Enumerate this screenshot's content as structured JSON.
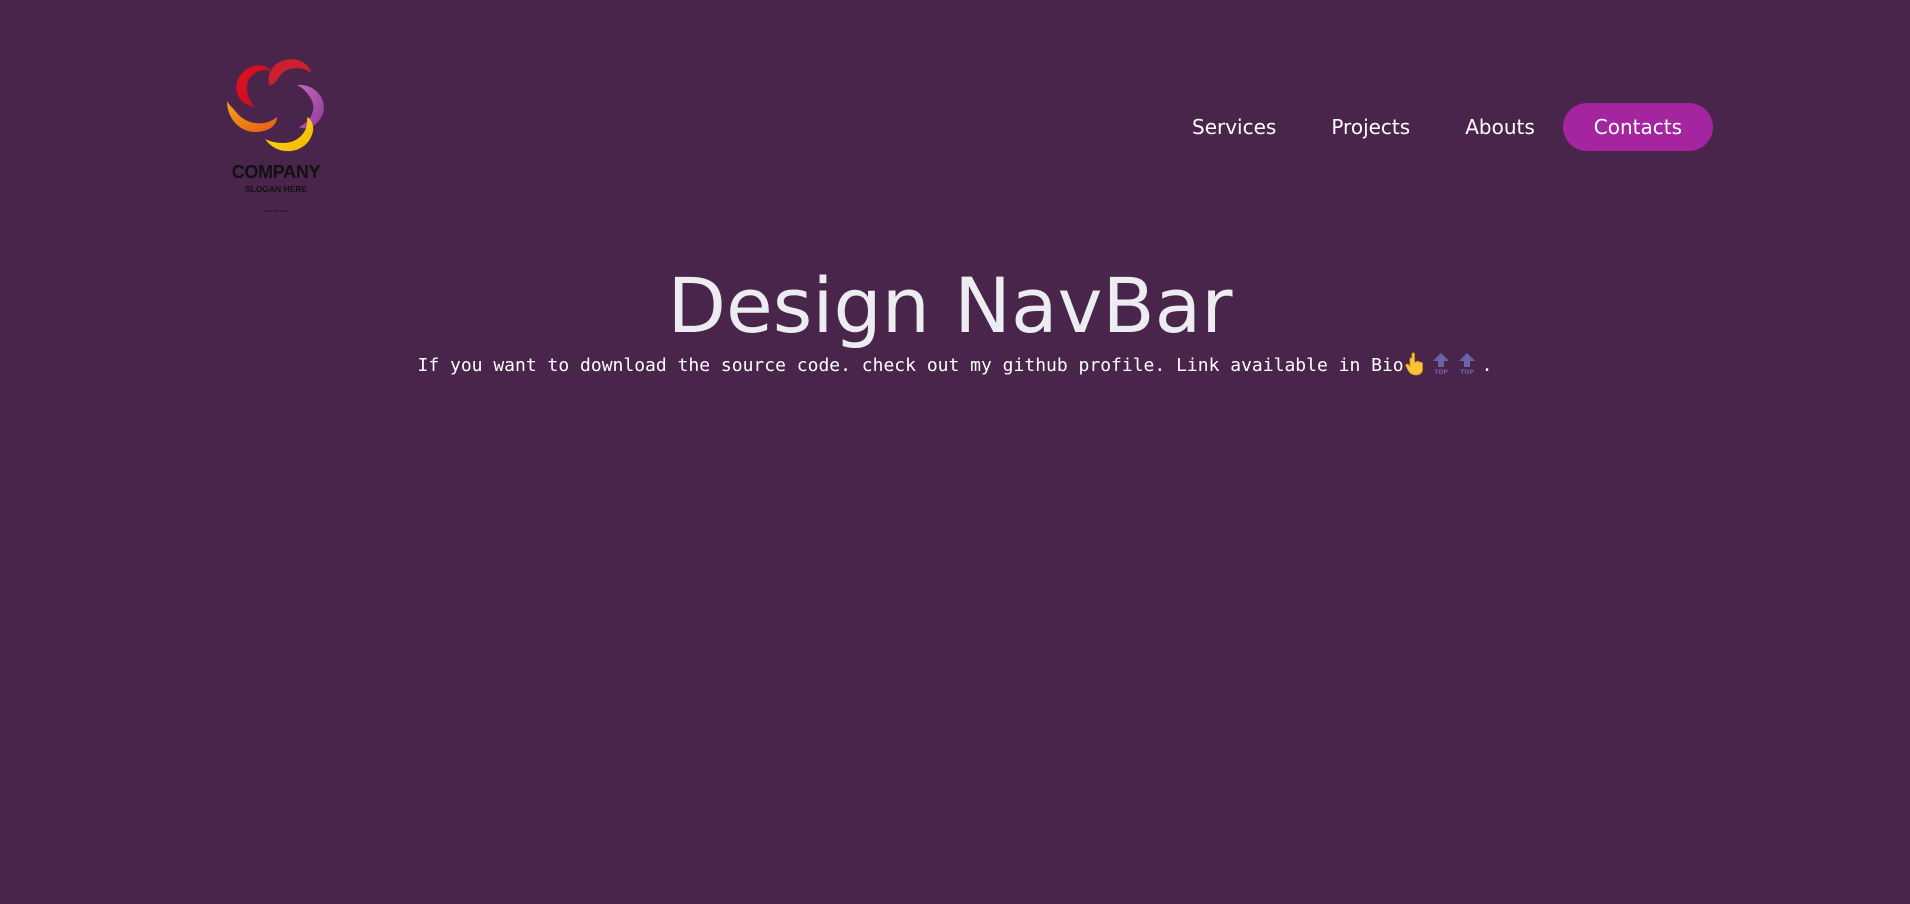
{
  "logo": {
    "company": "COMPANY",
    "slogan": "SLOGAN HERE",
    "site": "yoursite.com"
  },
  "nav": {
    "items": [
      {
        "label": "Services",
        "active": false
      },
      {
        "label": "Projects",
        "active": false
      },
      {
        "label": "Abouts",
        "active": false
      },
      {
        "label": "Contacts",
        "active": true
      }
    ]
  },
  "hero": {
    "title": "Design NavBar",
    "subtitle": "If you want to download the source code. check out my github profile. Link available in Bio",
    "subtitle_end": ".",
    "emoji_icon": "pointing-up-hand-icon",
    "top_icon": "top-arrow-icon",
    "top_label": "TOP"
  },
  "colors": {
    "background": "#4a254b",
    "accent": "#a4259f",
    "title": "#ececf1",
    "text": "#ffffff"
  }
}
